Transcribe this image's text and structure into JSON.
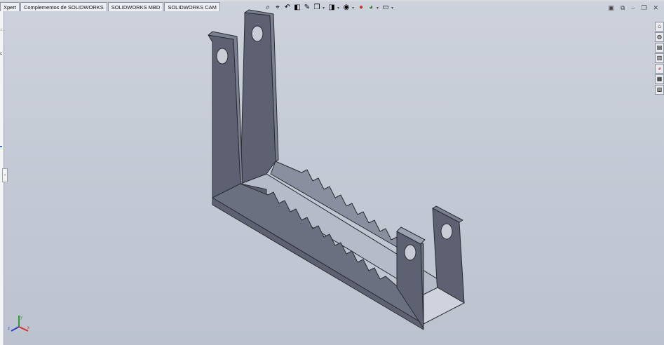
{
  "command_manager": {
    "tabs": [
      "Xpert",
      "Complementos de SOLIDWORKS",
      "SOLIDWORKS MBD",
      "SOLIDWORKS CAM"
    ]
  },
  "left_panel": {
    "mark_1": "↕",
    "mark_2": "c",
    "collapse_glyph": "›"
  },
  "heads_up_toolbar": {
    "icons": [
      "zoom-to-fit-icon",
      "zoom-to-area-icon",
      "previous-view-icon",
      "section-view-icon",
      "dynamic-annotation-icon",
      "view-orientation-icon",
      "display-style-icon",
      "hide-show-items-icon",
      "edit-appearance-icon",
      "apply-scene-icon",
      "view-settings-icon"
    ],
    "glyphs": {
      "zoom_fit": "⌕",
      "zoom_area": "⌖",
      "prev_view": "↶",
      "section": "◧",
      "annot": "✎",
      "orientation": "❒",
      "display": "◨",
      "hide_show": "◉",
      "appearance": "●",
      "scene": "◕",
      "view_settings": "▭",
      "dropdown": "▾"
    }
  },
  "window_controls": {
    "tile": "▣",
    "restore_split": "⧉",
    "minimize": "–",
    "maximize": "❐",
    "close": "✕"
  },
  "task_pane": {
    "tabs": [
      {
        "name": "home-icon",
        "glyph": "⌂"
      },
      {
        "name": "resources-icon",
        "glyph": "◍"
      },
      {
        "name": "design-library-icon",
        "glyph": "▤"
      },
      {
        "name": "file-explorer-icon",
        "glyph": "▥"
      },
      {
        "name": "appearances-icon",
        "glyph": "◕"
      },
      {
        "name": "custom-properties-icon",
        "glyph": "▦"
      },
      {
        "name": "forum-icon",
        "glyph": "▨"
      }
    ]
  },
  "triad": {
    "x_label": "x",
    "y_label": "y",
    "z_label": "z"
  },
  "colors": {
    "background_top": "#cdd2dc",
    "model_face_dark": "#5d6171",
    "model_face_mid": "#7b8090",
    "model_face_light": "#b6bbc9",
    "model_edge": "#2a2c33",
    "axis_x": "#d4302a",
    "axis_y": "#2f9a32",
    "axis_z": "#2d3fc4"
  }
}
